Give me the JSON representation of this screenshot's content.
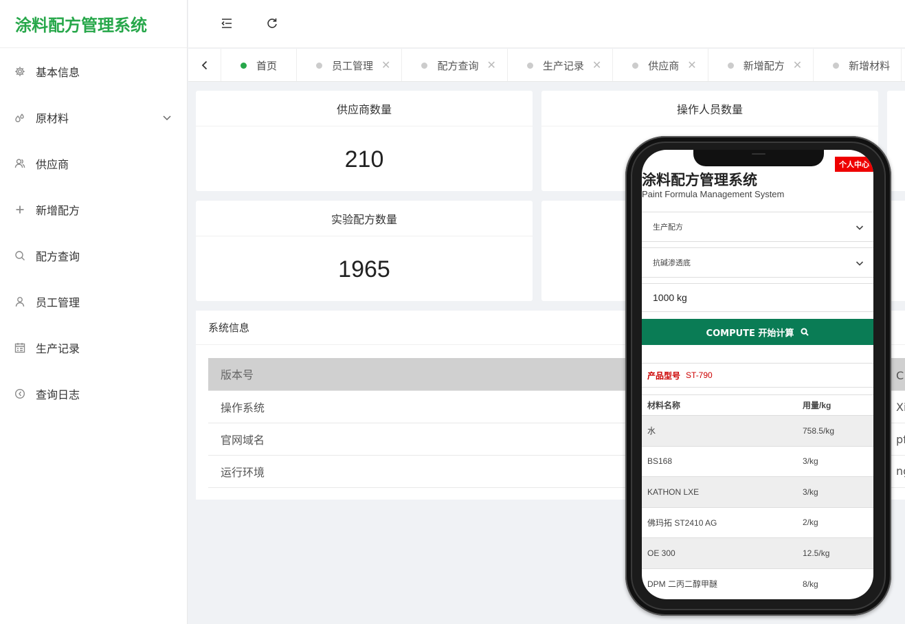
{
  "app": {
    "title": "涂料配方管理系统"
  },
  "sidebar": {
    "items": [
      {
        "label": "基本信息",
        "icon": "gear-icon"
      },
      {
        "label": "原材料",
        "icon": "drops-icon",
        "has_submenu": true
      },
      {
        "label": "供应商",
        "icon": "users-icon"
      },
      {
        "label": "新增配方",
        "icon": "plus-icon"
      },
      {
        "label": "配方查询",
        "icon": "search-icon"
      },
      {
        "label": "员工管理",
        "icon": "user-icon"
      },
      {
        "label": "生产记录",
        "icon": "calendar-icon"
      },
      {
        "label": "查询日志",
        "icon": "clock-icon"
      }
    ]
  },
  "header": {
    "collapse_icon": "menu-fold-icon",
    "refresh_icon": "refresh-icon"
  },
  "tabs": [
    {
      "label": "首页",
      "active": true,
      "closable": false
    },
    {
      "label": "员工管理",
      "active": false,
      "closable": true
    },
    {
      "label": "配方查询",
      "active": false,
      "closable": true
    },
    {
      "label": "生产记录",
      "active": false,
      "closable": true
    },
    {
      "label": "供应商",
      "active": false,
      "closable": true
    },
    {
      "label": "新增配方",
      "active": false,
      "closable": true
    },
    {
      "label": "新增材料",
      "active": false,
      "closable": false
    }
  ],
  "stats": [
    {
      "title": "供应商数量",
      "value": "210"
    },
    {
      "title": "操作人员数量",
      "value": ""
    },
    {
      "title": "实验配方数量",
      "value": "1965"
    }
  ],
  "system_info": {
    "title": "系统信息",
    "rows": [
      {
        "key": "版本号",
        "value": "C"
      },
      {
        "key": "操作系统",
        "value": "Xi"
      },
      {
        "key": "官网域名",
        "value": "pf"
      },
      {
        "key": "运行环境",
        "value": "ng"
      }
    ]
  },
  "phone": {
    "badge": "个人中心",
    "title": "涂料配方管理系统",
    "subtitle": "Paint Formula Management System",
    "select1": "生产配方",
    "select2": "抗碱渗透底",
    "quantity": "1000 kg",
    "compute_label": "COMPUTE 开始计算",
    "model_label": "产品型号",
    "model_value": "ST-790",
    "table_headers": [
      "材料名称",
      "用量/kg"
    ],
    "rows": [
      {
        "name": "水",
        "amount": "758.5/kg"
      },
      {
        "name": "BS168",
        "amount": "3/kg"
      },
      {
        "name": "KATHON LXE",
        "amount": "3/kg"
      },
      {
        "name": "佛玛拓 ST2410 AG",
        "amount": "2/kg"
      },
      {
        "name": "OE 300",
        "amount": "12.5/kg"
      },
      {
        "name": "DPM 二丙二醇甲醚",
        "amount": "8/kg"
      }
    ]
  },
  "colors": {
    "brand_green": "#27a74a",
    "compute_green": "#0a7c55",
    "badge_red": "#ee0000"
  }
}
